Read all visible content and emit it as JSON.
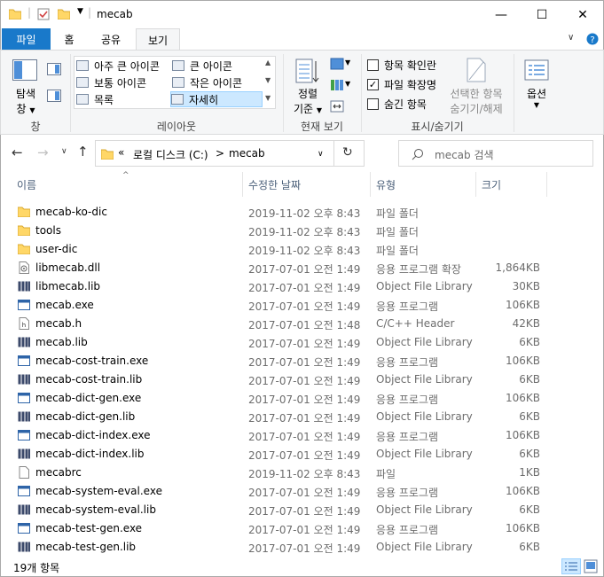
{
  "window": {
    "title": "mecab",
    "minimize": "—",
    "maximize": "☐",
    "close": "✕"
  },
  "ribbon_tabs": {
    "file": "파일",
    "home": "홈",
    "share": "공유",
    "view": "보기"
  },
  "ribbon": {
    "panes": {
      "nav_pane_label": "탐색",
      "nav_pane_label2": "창",
      "group": "창"
    },
    "layout": {
      "items": [
        "아주 큰 아이콘",
        "큰 아이콘",
        "보통 아이콘",
        "작은 아이콘",
        "목록",
        "자세히"
      ],
      "group": "레이아웃"
    },
    "current_view": {
      "sort_label": "정렬",
      "sort_label2": "기준",
      "group": "현재 보기"
    },
    "show_hide": {
      "item_checkbox": "항목 확인란",
      "file_extensions": "파일 확장명",
      "hidden_items": "숨긴 항목",
      "hide_selected": "선택한 항목",
      "hide_selected2": "숨기기/해제",
      "group": "표시/숨기기"
    },
    "options": "옵션"
  },
  "address": {
    "chevrons": "«",
    "crumb1": "로컬 디스크 (C:)",
    "sep": ">",
    "crumb2": "mecab",
    "search_placeholder": "mecab 검색"
  },
  "columns": {
    "name": "이름",
    "date": "수정한 날짜",
    "type": "유형",
    "size": "크기"
  },
  "files": [
    {
      "name": "mecab-ko-dic",
      "date": "2019-11-02 오후 8:43",
      "type": "파일 폴더",
      "size": "",
      "icon": "folder"
    },
    {
      "name": "tools",
      "date": "2019-11-02 오후 8:43",
      "type": "파일 폴더",
      "size": "",
      "icon": "folder"
    },
    {
      "name": "user-dic",
      "date": "2019-11-02 오후 8:43",
      "type": "파일 폴더",
      "size": "",
      "icon": "folder"
    },
    {
      "name": "libmecab.dll",
      "date": "2017-07-01 오전 1:49",
      "type": "응용 프로그램 확장",
      "size": "1,864KB",
      "icon": "dll"
    },
    {
      "name": "libmecab.lib",
      "date": "2017-07-01 오전 1:49",
      "type": "Object File Library",
      "size": "30KB",
      "icon": "lib"
    },
    {
      "name": "mecab.exe",
      "date": "2017-07-01 오전 1:49",
      "type": "응용 프로그램",
      "size": "106KB",
      "icon": "exe"
    },
    {
      "name": "mecab.h",
      "date": "2017-07-01 오전 1:48",
      "type": "C/C++ Header",
      "size": "42KB",
      "icon": "header"
    },
    {
      "name": "mecab.lib",
      "date": "2017-07-01 오전 1:49",
      "type": "Object File Library",
      "size": "6KB",
      "icon": "lib"
    },
    {
      "name": "mecab-cost-train.exe",
      "date": "2017-07-01 오전 1:49",
      "type": "응용 프로그램",
      "size": "106KB",
      "icon": "exe"
    },
    {
      "name": "mecab-cost-train.lib",
      "date": "2017-07-01 오전 1:49",
      "type": "Object File Library",
      "size": "6KB",
      "icon": "lib"
    },
    {
      "name": "mecab-dict-gen.exe",
      "date": "2017-07-01 오전 1:49",
      "type": "응용 프로그램",
      "size": "106KB",
      "icon": "exe"
    },
    {
      "name": "mecab-dict-gen.lib",
      "date": "2017-07-01 오전 1:49",
      "type": "Object File Library",
      "size": "6KB",
      "icon": "lib"
    },
    {
      "name": "mecab-dict-index.exe",
      "date": "2017-07-01 오전 1:49",
      "type": "응용 프로그램",
      "size": "106KB",
      "icon": "exe"
    },
    {
      "name": "mecab-dict-index.lib",
      "date": "2017-07-01 오전 1:49",
      "type": "Object File Library",
      "size": "6KB",
      "icon": "lib"
    },
    {
      "name": "mecabrc",
      "date": "2019-11-02 오후 8:43",
      "type": "파일",
      "size": "1KB",
      "icon": "file"
    },
    {
      "name": "mecab-system-eval.exe",
      "date": "2017-07-01 오전 1:49",
      "type": "응용 프로그램",
      "size": "106KB",
      "icon": "exe"
    },
    {
      "name": "mecab-system-eval.lib",
      "date": "2017-07-01 오전 1:49",
      "type": "Object File Library",
      "size": "6KB",
      "icon": "lib"
    },
    {
      "name": "mecab-test-gen.exe",
      "date": "2017-07-01 오전 1:49",
      "type": "응용 프로그램",
      "size": "106KB",
      "icon": "exe"
    },
    {
      "name": "mecab-test-gen.lib",
      "date": "2017-07-01 오전 1:49",
      "type": "Object File Library",
      "size": "6KB",
      "icon": "lib"
    }
  ],
  "status": {
    "count": "19개 항목"
  },
  "colors": {
    "accent": "#1979ca",
    "folder": "#ffd767",
    "selected": "#cce8ff"
  }
}
